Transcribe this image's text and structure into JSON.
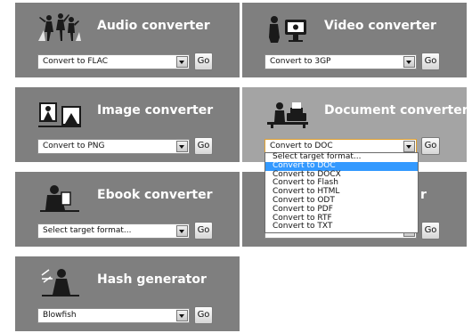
{
  "panels": {
    "audio": {
      "title": "Audio converter",
      "select_value": "Convert to FLAC",
      "go_label": "Go"
    },
    "video": {
      "title": "Video converter",
      "select_value": "Convert to 3GP",
      "go_label": "Go"
    },
    "image": {
      "title": "Image converter",
      "select_value": "Convert to PNG",
      "go_label": "Go"
    },
    "document": {
      "title": "Document converter",
      "select_value": "Convert to DOC",
      "go_label": "Go"
    },
    "ebook": {
      "title": "Ebook converter",
      "select_value": "Select target format...",
      "go_label": "Go"
    },
    "hidden": {
      "title_fragment": "r",
      "go_label": "Go"
    },
    "hash": {
      "title": "Hash generator",
      "select_value": "Blowfish",
      "go_label": "Go"
    }
  },
  "document_dropdown": {
    "options": [
      "Select target format...",
      "Convert to DOC",
      "Convert to DOCX",
      "Convert to Flash",
      "Convert to HTML",
      "Convert to ODT",
      "Convert to PDF",
      "Convert to RTF",
      "Convert to TXT"
    ],
    "selected_index": 1
  },
  "icons": {
    "audio": "dancers-icon",
    "video": "tv-viewer-icon",
    "image": "photo-frames-icon",
    "document": "typewriter-icon",
    "ebook": "reader-icon",
    "hash": "hash-figure-icon"
  },
  "colors": {
    "panel_bg": "#7f7f7f",
    "panel_active_bg": "#a4a4a4",
    "selection": "#3399ff",
    "active_border": "#e0a030"
  }
}
